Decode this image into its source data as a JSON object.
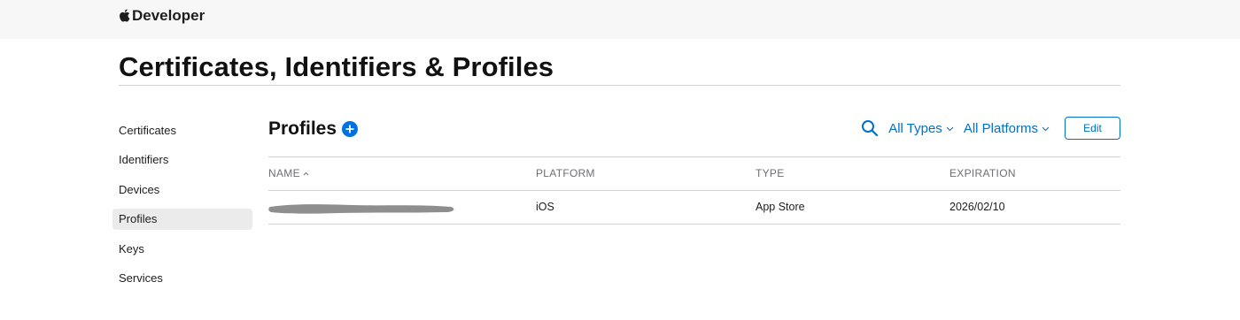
{
  "nav": {
    "brand_label": "Developer",
    "brand_icon": "apple-icon"
  },
  "page": {
    "title": "Certificates, Identifiers & Profiles"
  },
  "sidebar": {
    "items": [
      {
        "label": "Certificates",
        "active": false
      },
      {
        "label": "Identifiers",
        "active": false
      },
      {
        "label": "Devices",
        "active": false
      },
      {
        "label": "Profiles",
        "active": true
      },
      {
        "label": "Keys",
        "active": false
      },
      {
        "label": "Services",
        "active": false
      }
    ]
  },
  "section": {
    "title": "Profiles",
    "add_icon": "plus-circle-icon"
  },
  "toolbar": {
    "search_icon": "search-icon",
    "type_filter": "All Types",
    "platform_filter": "All Platforms",
    "edit_label": "Edit"
  },
  "table": {
    "columns": [
      "NAME",
      "PLATFORM",
      "TYPE",
      "EXPIRATION"
    ],
    "sort_column": "NAME",
    "sort_direction": "ascending",
    "rows": [
      {
        "name": "",
        "name_redacted": true,
        "platform": "iOS",
        "type": "App Store",
        "expiration": "2026/02/10"
      }
    ]
  },
  "colors": {
    "accent": "#0070c9",
    "nav_bg": "#f7f7f7",
    "active_item_bg": "#ebebeb",
    "divider": "#d2d2d7",
    "redaction": "#8e8e8e"
  }
}
